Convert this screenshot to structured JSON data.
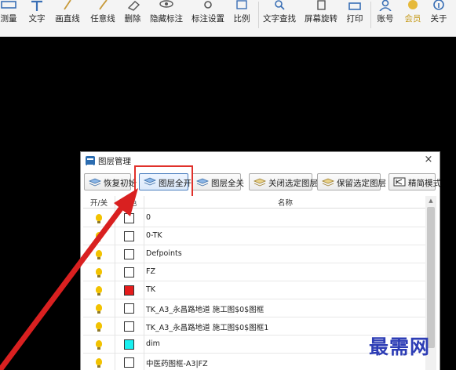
{
  "toolbar": {
    "items": [
      {
        "label": "测量",
        "icon": "ruler-icon"
      },
      {
        "label": "文字",
        "icon": "text-icon"
      },
      {
        "label": "画直线",
        "icon": "line-icon"
      },
      {
        "label": "任意线",
        "icon": "freehand-line-icon"
      },
      {
        "label": "删除",
        "icon": "eraser-icon"
      },
      {
        "label": "隐藏标注",
        "icon": "eye-icon"
      },
      {
        "label": "标注设置",
        "icon": "settings-icon"
      },
      {
        "label": "比例",
        "icon": "scale-icon"
      },
      {
        "label": "文字查找",
        "icon": "search-text-icon"
      },
      {
        "label": "屏幕旋转",
        "icon": "rotate-screen-icon"
      },
      {
        "label": "打印",
        "icon": "printer-icon"
      },
      {
        "label": "账号",
        "icon": "user-icon"
      },
      {
        "label": "会员",
        "icon": "vip-icon"
      },
      {
        "label": "关于",
        "icon": "info-icon"
      }
    ]
  },
  "dialog": {
    "title": "图层管理",
    "close": "×",
    "buttons": {
      "restore": "恢复初始",
      "all_on": "图层全开",
      "all_off": "图层全关",
      "close_selected": "关闭选定图层",
      "keep_selected": "保留选定图层",
      "simple_mode": "精简模式"
    },
    "columns": {
      "onoff": "开/关",
      "color": "颜色",
      "name": "名称"
    },
    "layers": [
      {
        "name": "0",
        "color": "#ffffff"
      },
      {
        "name": "0-TK",
        "color": "#ffffff"
      },
      {
        "name": "Defpoints",
        "color": "#ffffff"
      },
      {
        "name": "FZ",
        "color": "#ffffff"
      },
      {
        "name": "TK",
        "color": "#e51c1c"
      },
      {
        "name": "TK_A3_永昌路地道 施工图$0$图框",
        "color": "#ffffff"
      },
      {
        "name": "TK_A3_永昌路地道 施工图$0$图框1",
        "color": "#ffffff"
      },
      {
        "name": "dim",
        "color": "#19f0f0"
      },
      {
        "name": "中医药图框-A3|FZ",
        "color": "#ffffff"
      }
    ]
  },
  "watermark": "最需网",
  "colors": {
    "highlight": "#e0302a",
    "arrow": "#d92020",
    "watermark": "#2d3db5"
  }
}
